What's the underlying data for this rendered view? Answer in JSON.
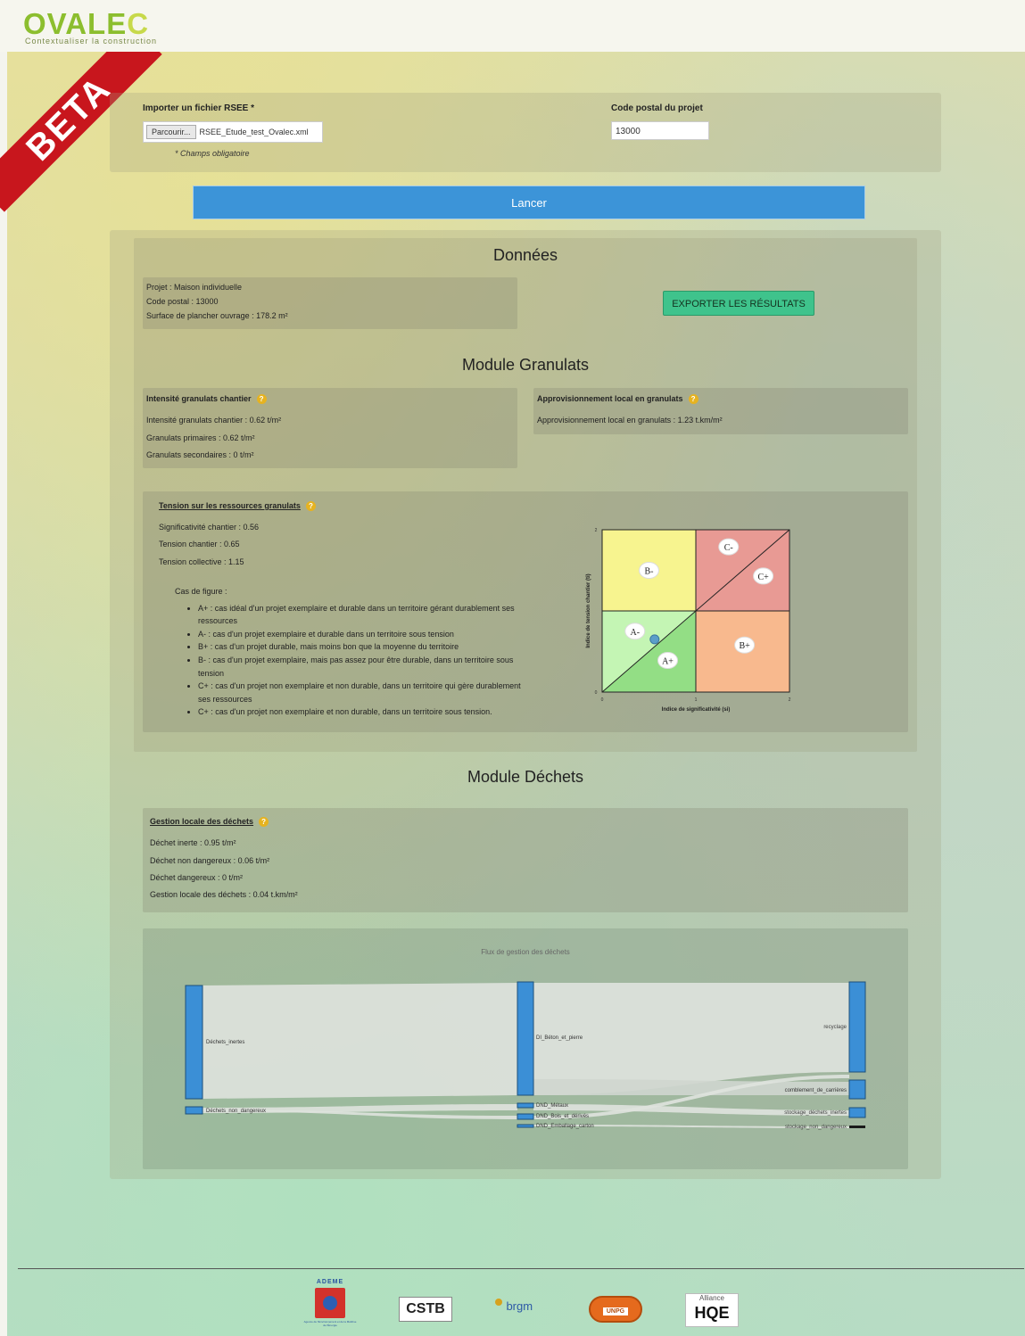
{
  "header": {
    "logo_text": "OVALEC",
    "logo_main": "OVALE",
    "logo_last": "C",
    "logo_subtitle": "Contextualiser la construction",
    "beta_label": "BETA"
  },
  "form": {
    "file_label": "Importer un fichier RSEE *",
    "file_button": "Parcourir...",
    "file_name": "RSEE_Etude_test_Ovalec.xml",
    "postal_label": "Code postal du projet",
    "postal_value": "13000",
    "required_note": "* Champs obligatoire",
    "launch_label": "Lancer"
  },
  "donnees": {
    "title": "Données",
    "projet": "Projet : Maison individuelle",
    "code_postal": "Code postal : 13000",
    "surface": "Surface de plancher ouvrage : 178.2 m²",
    "export_label": "EXPORTER LES RÉSULTATS"
  },
  "granulats": {
    "title": "Module Granulats",
    "intensite_title": "Intensité granulats chantier",
    "intensite_lines": [
      "Intensité granulats chantier : 0.62 t/m²",
      "Granulats primaires : 0.62 t/m²",
      "Granulats secondaires : 0 t/m²"
    ],
    "appro_title": "Approvisionnement local en granulats",
    "appro_line": "Approvisionnement local en granulats : 1.23 t.km/m²",
    "tension_title": "Tension sur les ressources granulats",
    "tension_lines": [
      "Significativité chantier : 0.56",
      "Tension chantier : 0.65",
      "Tension collective : 1.15"
    ],
    "cases_title": "Cas de figure :",
    "cases": [
      "A+ : cas idéal d'un projet exemplaire et durable dans un territoire gérant durablement ses ressources",
      "A- : cas d'un projet exemplaire et durable dans un territoire sous tension",
      "B+ : cas d'un projet durable, mais moins bon que la moyenne du territoire",
      "B- : cas d'un projet exemplaire, mais pas assez pour être durable, dans un territoire sous tension",
      "C+ : cas d'un projet non exemplaire et non durable, dans un territoire qui gère durablement ses ressources",
      "C+ : cas d'un projet non exemplaire et non durable, dans un territoire sous tension."
    ]
  },
  "chart_data": {
    "type": "scatter",
    "xlabel": "Indice de significativité (si)",
    "ylabel": "Indice de tension chantier (ti)",
    "xlim": [
      0,
      2
    ],
    "ylim": [
      0,
      2
    ],
    "x_ticks": [
      "0",
      "1",
      "2"
    ],
    "y_ticks": [
      "0",
      "2"
    ],
    "zones": [
      {
        "label": "B-",
        "color": "#f7f48f"
      },
      {
        "label": "C-",
        "color": "#e89a94"
      },
      {
        "label": "C+",
        "color": "#e89a94"
      },
      {
        "label": "A-",
        "color": "#c4f5b4"
      },
      {
        "label": "A+",
        "color": "#93de85"
      },
      {
        "label": "B+",
        "color": "#f8b98e"
      }
    ],
    "point": {
      "x": 0.56,
      "y": 0.65,
      "color": "#5b9ec9"
    }
  },
  "dechets": {
    "title": "Module Déchets",
    "gestion_title": "Gestion locale des déchets",
    "lines": [
      "Déchet inerte : 0.95 t/m²",
      "Déchet non dangereux : 0.06 t/m²",
      "Déchet dangereux : 0 t/m²",
      "Gestion locale des déchets : 0.04 t.km/m²"
    ],
    "sankey_title": "Flux de gestion des déchets",
    "sankey_nodes": {
      "left": [
        "Déchets_inertes",
        "Déchets_non_dangereux"
      ],
      "middle": [
        "DI_Béton_et_pierre",
        "DND_Métaux",
        "DND_Bois_et_dérivés",
        "DND_Emballage_carton"
      ],
      "right": [
        "recyclage",
        "comblement_de_carrières",
        "stockage_déchets_inertes",
        "stockage_non_dangereux"
      ]
    }
  },
  "footer": {
    "ademe": "ADEME",
    "ademe_caption": "Agence de l'Environnement et de la Maîtrise de l'Énergie",
    "cstb": "CSTB",
    "brgm": "brgm",
    "unpg": "UNPG",
    "alliance": "Alliance",
    "hqe": "HQE"
  }
}
